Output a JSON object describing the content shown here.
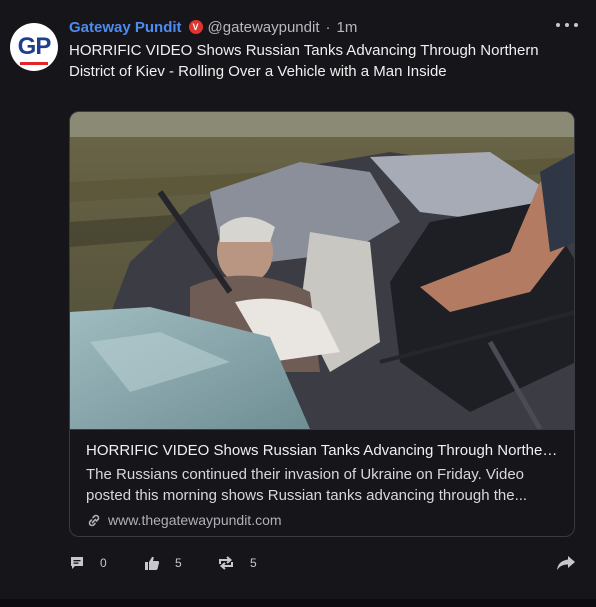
{
  "post": {
    "avatar_text": "GP",
    "display_name": "Gateway Pundit",
    "verified_mark": "V",
    "handle": "@gatewaypundit",
    "separator": "·",
    "timestamp": "1m",
    "text": "HORRIFIC VIDEO Shows Russian Tanks Advancing Through Northern District of Kiev - Rolling Over a Vehicle with a Man Inside"
  },
  "link_card": {
    "title": "HORRIFIC VIDEO Shows Russian Tanks Advancing Through Northern...",
    "description": "The Russians continued their invasion of Ukraine on Friday. Video posted this morning shows Russian tanks advancing through the...",
    "url": "www.thegatewaypundit.com",
    "url_icon": "link-icon"
  },
  "actions": {
    "reply": {
      "icon": "comment-icon",
      "count": "0"
    },
    "like": {
      "icon": "thumbs-up-icon",
      "count": "5"
    },
    "reblog": {
      "icon": "repost-icon",
      "count": "5"
    },
    "share": {
      "icon": "share-arrow-icon"
    }
  },
  "colors": {
    "background": "#15151a",
    "name_blue": "#4c8cf0",
    "verified_red": "#e0342f",
    "border": "#3a3a42"
  }
}
